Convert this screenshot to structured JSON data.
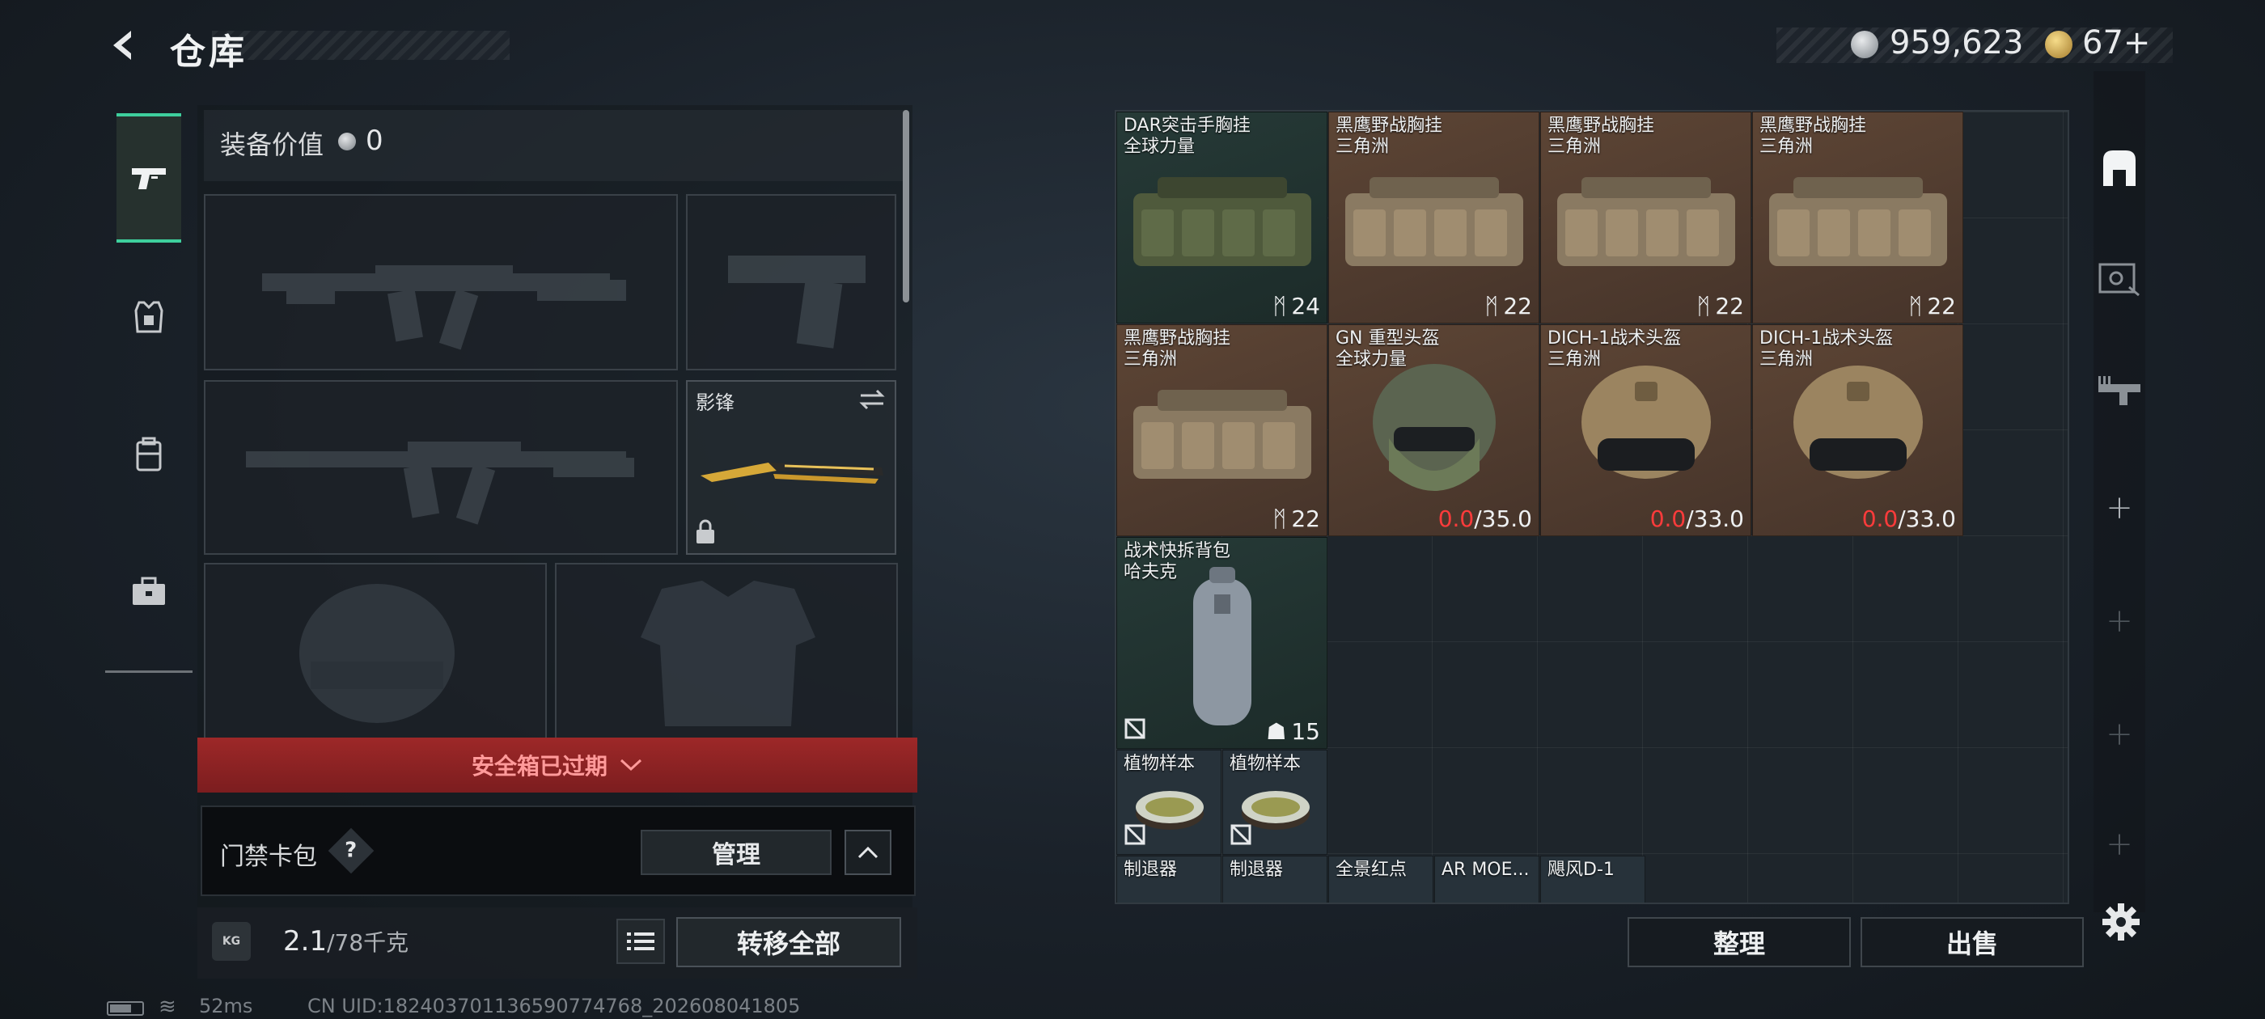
{
  "header": {
    "title": "仓库",
    "back_icon": "back-arrow-icon",
    "currency_silver": "959,623",
    "currency_gold": "67+"
  },
  "tabs": [
    {
      "name": "weapons",
      "icon": "pistol-icon",
      "active": true
    },
    {
      "name": "armor",
      "icon": "armor-icon",
      "active": false
    },
    {
      "name": "backpack",
      "icon": "backpack-icon",
      "active": false
    },
    {
      "name": "toolbox",
      "icon": "toolbox-icon",
      "active": false
    }
  ],
  "equipment": {
    "value_label": "装备价值",
    "value": "0",
    "knife_slot_label": "影锋"
  },
  "safe_box": {
    "banner": "安全箱已过期"
  },
  "keycard": {
    "label": "门禁卡包",
    "help": "?",
    "manage": "管理"
  },
  "capacity": {
    "kg_icon": "KG",
    "weight": "2.1",
    "capacity": "/78千克",
    "transfer_all": "转移全部"
  },
  "status": {
    "ping": "52ms",
    "uid": "CN UID:18240370113659077476​8_202608041805"
  },
  "stash_items": [
    {
      "line1": "DAR突击手胸挂",
      "line2": "全球力量",
      "count": "24",
      "type": "chest-rig-green"
    },
    {
      "line1": "黑鹰野战胸挂",
      "line2": "三角洲",
      "count": "22",
      "type": "chest-rig-tan"
    },
    {
      "line1": "黑鹰野战胸挂",
      "line2": "三角洲",
      "count": "22",
      "type": "chest-rig-tan"
    },
    {
      "line1": "黑鹰野战胸挂",
      "line2": "三角洲",
      "count": "22",
      "type": "chest-rig-tan"
    },
    {
      "line1": "黑鹰野战胸挂",
      "line2": "三角洲",
      "count": "22",
      "type": "chest-rig-tan"
    },
    {
      "line1": "GN 重型头盔",
      "line2": "全球力量",
      "dura_cur": "0.0",
      "dura_max": "/35.0",
      "type": "helmet-green"
    },
    {
      "line1": "DICH-1战术头盔",
      "line2": "三角洲",
      "dura_cur": "0.0",
      "dura_max": "/33.0",
      "type": "helmet-tan"
    },
    {
      "line1": "DICH-1战术头盔",
      "line2": "三角洲",
      "dura_cur": "0.0",
      "dura_max": "/33.0",
      "type": "helmet-tan"
    },
    {
      "line1": "战术快拆背包",
      "line2": "哈夫克",
      "count": "15",
      "type": "backpack"
    },
    {
      "line1": "植物样本",
      "type": "sample"
    },
    {
      "line1": "植物样本",
      "type": "sample"
    },
    {
      "line1": "制退器",
      "type": "attachment"
    },
    {
      "line1": "制退器",
      "type": "attachment"
    },
    {
      "line1": "全景红点",
      "type": "attachment"
    },
    {
      "line1": "AR MOE...",
      "type": "attachment"
    },
    {
      "line1": "飓风D-1",
      "type": "attachment"
    }
  ],
  "actions": {
    "sort": "整理",
    "sell": "出售"
  },
  "colors": {
    "accent": "#3ecf9d",
    "danger_banner": "#9d2828",
    "durability_red": "#ff3b3b",
    "rare_item_bg": "#5d4535",
    "teal_item_bg": "#263a37"
  }
}
